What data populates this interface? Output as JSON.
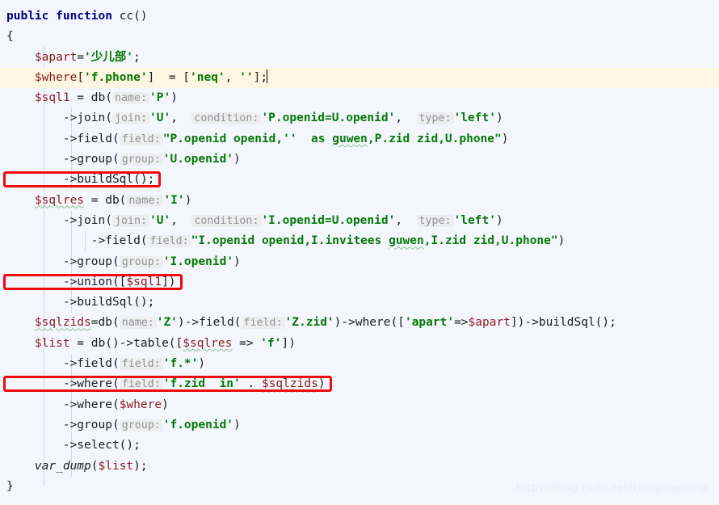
{
  "editor": {
    "language": "PHP",
    "background_color": "#f3f7fd",
    "highlight_line_color": "#fdf6e0",
    "keyword_color": "#000080",
    "string_color": "#077807",
    "variable_color": "#8b1a1a",
    "hint_color": "#8f9298",
    "annotation_color": "#f00b0b",
    "caret_line_index": 3
  },
  "watermark": {
    "text": "https://blog.csdn.net/xiongxiaoning"
  },
  "code": {
    "lines": [
      {
        "indent": 0,
        "tokens": [
          {
            "t": "kw",
            "v": "public function "
          },
          {
            "t": "plain",
            "v": "cc()"
          }
        ]
      },
      {
        "indent": 0,
        "tokens": [
          {
            "t": "plain",
            "v": "{"
          }
        ]
      },
      {
        "indent": 1,
        "tokens": [
          {
            "t": "var",
            "v": "$apart"
          },
          {
            "t": "plain",
            "v": "="
          },
          {
            "t": "str",
            "v": "'少儿部'"
          },
          {
            "t": "plain",
            "v": ";"
          }
        ]
      },
      {
        "indent": 1,
        "highlight": true,
        "caret": true,
        "tokens": [
          {
            "t": "var",
            "v": "$where"
          },
          {
            "t": "plain",
            "v": "["
          },
          {
            "t": "str",
            "v": "'f.phone'"
          },
          {
            "t": "plain",
            "v": "]  = ["
          },
          {
            "t": "str",
            "v": "'neq'"
          },
          {
            "t": "plain",
            "v": ", "
          },
          {
            "t": "str",
            "v": "''"
          },
          {
            "t": "plain",
            "v": "];"
          }
        ]
      },
      {
        "indent": 1,
        "tokens": [
          {
            "t": "var",
            "v": "$sql1"
          },
          {
            "t": "plain",
            "v": " = db("
          },
          {
            "t": "hint",
            "v": "name:"
          },
          {
            "t": "str",
            "v": "'P'"
          },
          {
            "t": "plain",
            "v": ")"
          }
        ]
      },
      {
        "indent": 2,
        "tokens": [
          {
            "t": "plain",
            "v": "->join("
          },
          {
            "t": "hint",
            "v": "join:"
          },
          {
            "t": "str",
            "v": "'U'"
          },
          {
            "t": "plain",
            "v": ",  "
          },
          {
            "t": "hint",
            "v": "condition:"
          },
          {
            "t": "str",
            "v": "'P.openid=U.openid'"
          },
          {
            "t": "plain",
            "v": ",  "
          },
          {
            "t": "hint",
            "v": "type:"
          },
          {
            "t": "str",
            "v": "'left'"
          },
          {
            "t": "plain",
            "v": ")"
          }
        ]
      },
      {
        "indent": 2,
        "tokens": [
          {
            "t": "plain",
            "v": "->field("
          },
          {
            "t": "hint",
            "v": "field:"
          },
          {
            "t": "str",
            "v": "\"P.openid openid,''  as "
          },
          {
            "t": "str-typo",
            "v": "guwen"
          },
          {
            "t": "str",
            "v": ",P.zid zid,U.phone\""
          },
          {
            "t": "plain",
            "v": ")"
          }
        ]
      },
      {
        "indent": 2,
        "tokens": [
          {
            "t": "plain",
            "v": "->group("
          },
          {
            "t": "hint",
            "v": "group:"
          },
          {
            "t": "str",
            "v": "'U.openid'"
          },
          {
            "t": "plain",
            "v": ")"
          }
        ]
      },
      {
        "indent": 2,
        "boxed": true,
        "tokens": [
          {
            "t": "plain",
            "v": "->buildSql();"
          }
        ]
      },
      {
        "indent": 1,
        "tokens": [
          {
            "t": "var-typo",
            "v": "$sqlres"
          },
          {
            "t": "plain",
            "v": " = db("
          },
          {
            "t": "hint",
            "v": "name:"
          },
          {
            "t": "str",
            "v": "'I'"
          },
          {
            "t": "plain",
            "v": ")"
          }
        ]
      },
      {
        "indent": 2,
        "tokens": [
          {
            "t": "plain",
            "v": "->join("
          },
          {
            "t": "hint",
            "v": "join:"
          },
          {
            "t": "str",
            "v": "'U'"
          },
          {
            "t": "plain",
            "v": ",  "
          },
          {
            "t": "hint",
            "v": "condition:"
          },
          {
            "t": "str",
            "v": "'I.openid=U.openid'"
          },
          {
            "t": "plain",
            "v": ",  "
          },
          {
            "t": "hint",
            "v": "type:"
          },
          {
            "t": "str",
            "v": "'left'"
          },
          {
            "t": "plain",
            "v": ")"
          }
        ]
      },
      {
        "indent": 3,
        "tokens": [
          {
            "t": "plain",
            "v": "->field("
          },
          {
            "t": "hint",
            "v": "field:"
          },
          {
            "t": "str",
            "v": "\"I.openid openid,I.invitees "
          },
          {
            "t": "str-typo",
            "v": "guwen"
          },
          {
            "t": "str",
            "v": ",I.zid zid,U.phone\""
          },
          {
            "t": "plain",
            "v": ")"
          }
        ]
      },
      {
        "indent": 2,
        "tokens": [
          {
            "t": "plain",
            "v": "->group("
          },
          {
            "t": "hint",
            "v": "group:"
          },
          {
            "t": "str",
            "v": "'I.openid'"
          },
          {
            "t": "plain",
            "v": ")"
          }
        ]
      },
      {
        "indent": 2,
        "boxed": true,
        "tokens": [
          {
            "t": "plain",
            "v": "->union(["
          },
          {
            "t": "var",
            "v": "$sql1"
          },
          {
            "t": "plain",
            "v": "])"
          }
        ]
      },
      {
        "indent": 2,
        "tokens": [
          {
            "t": "plain",
            "v": "->buildSql();"
          }
        ]
      },
      {
        "indent": 1,
        "tokens": [
          {
            "t": "var-typo",
            "v": "$sqlzids"
          },
          {
            "t": "plain",
            "v": "=db("
          },
          {
            "t": "hint",
            "v": "name:"
          },
          {
            "t": "str",
            "v": "'Z'"
          },
          {
            "t": "plain",
            "v": ")->field("
          },
          {
            "t": "hint",
            "v": "field:"
          },
          {
            "t": "str",
            "v": "'Z.zid'"
          },
          {
            "t": "plain",
            "v": ")->where(["
          },
          {
            "t": "str",
            "v": "'apart'"
          },
          {
            "t": "plain",
            "v": "=>"
          },
          {
            "t": "var",
            "v": "$apart"
          },
          {
            "t": "plain",
            "v": "])->buildSql();"
          }
        ]
      },
      {
        "indent": 1,
        "tokens": [
          {
            "t": "var",
            "v": "$list"
          },
          {
            "t": "plain",
            "v": " = db()->table(["
          },
          {
            "t": "var-typo",
            "v": "$sqlres"
          },
          {
            "t": "plain",
            "v": " => "
          },
          {
            "t": "str",
            "v": "'f'"
          },
          {
            "t": "plain",
            "v": "])"
          }
        ]
      },
      {
        "indent": 2,
        "tokens": [
          {
            "t": "plain",
            "v": "->field("
          },
          {
            "t": "hint",
            "v": "field:"
          },
          {
            "t": "str",
            "v": "'f.*'"
          },
          {
            "t": "plain",
            "v": ")"
          }
        ]
      },
      {
        "indent": 2,
        "boxed": true,
        "tokens": [
          {
            "t": "plain",
            "v": "->where("
          },
          {
            "t": "hint",
            "v": "field:"
          },
          {
            "t": "str",
            "v": "'f.zid  in'"
          },
          {
            "t": "plain",
            "v": " . "
          },
          {
            "t": "var-typo",
            "v": "$sqlzids"
          },
          {
            "t": "plain",
            "v": ")"
          }
        ]
      },
      {
        "indent": 2,
        "tokens": [
          {
            "t": "plain",
            "v": "->where("
          },
          {
            "t": "var",
            "v": "$where"
          },
          {
            "t": "plain",
            "v": ")"
          }
        ]
      },
      {
        "indent": 2,
        "tokens": [
          {
            "t": "plain",
            "v": "->group("
          },
          {
            "t": "hint",
            "v": "group:"
          },
          {
            "t": "str",
            "v": "'f.openid'"
          },
          {
            "t": "plain",
            "v": ")"
          }
        ]
      },
      {
        "indent": 2,
        "tokens": [
          {
            "t": "plain",
            "v": "->select();"
          }
        ]
      },
      {
        "indent": 1,
        "tokens": [
          {
            "t": "fn-italic",
            "v": "var_dump"
          },
          {
            "t": "plain",
            "v": "("
          },
          {
            "t": "var",
            "v": "$list"
          },
          {
            "t": "plain",
            "v": ");"
          }
        ]
      },
      {
        "indent": 0,
        "tokens": [
          {
            "t": "plain",
            "v": "}"
          }
        ]
      }
    ]
  },
  "annotations": {
    "boxes": [
      {
        "label": "buildSql-highlight-box",
        "line": 8
      },
      {
        "label": "union-highlight-box",
        "line": 13
      },
      {
        "label": "where-in-subquery-highlight-box",
        "line": 18
      }
    ]
  }
}
